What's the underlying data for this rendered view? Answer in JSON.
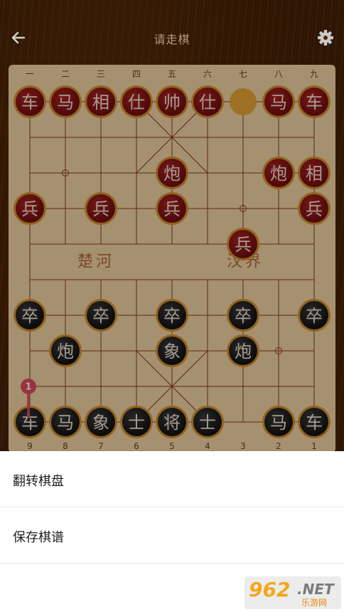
{
  "header": {
    "title": "请走棋"
  },
  "board": {
    "top_numerals": [
      "一",
      "二",
      "三",
      "四",
      "五",
      "六",
      "七",
      "八",
      "九"
    ],
    "bottom_numerals": [
      "9",
      "8",
      "7",
      "6",
      "5",
      "4",
      "3",
      "2",
      "1"
    ],
    "river_left": "楚河",
    "river_right": "汉界",
    "red_pieces": [
      {
        "ch": "车",
        "col": 0,
        "row": 0
      },
      {
        "ch": "马",
        "col": 1,
        "row": 0
      },
      {
        "ch": "相",
        "col": 2,
        "row": 0
      },
      {
        "ch": "仕",
        "col": 3,
        "row": 0
      },
      {
        "ch": "帅",
        "col": 4,
        "row": 0
      },
      {
        "ch": "仕",
        "col": 5,
        "row": 0
      },
      {
        "ch": "马",
        "col": 7,
        "row": 0
      },
      {
        "ch": "车",
        "col": 8,
        "row": 0
      },
      {
        "ch": "炮",
        "col": 4,
        "row": 2
      },
      {
        "ch": "炮",
        "col": 7,
        "row": 2
      },
      {
        "ch": "相",
        "col": 8,
        "row": 2
      },
      {
        "ch": "兵",
        "col": 0,
        "row": 3
      },
      {
        "ch": "兵",
        "col": 2,
        "row": 3
      },
      {
        "ch": "兵",
        "col": 4,
        "row": 3
      },
      {
        "ch": "兵",
        "col": 8,
        "row": 3
      },
      {
        "ch": "兵",
        "col": 6,
        "row": 4
      }
    ],
    "black_pieces": [
      {
        "ch": "卒",
        "col": 0,
        "row": 6
      },
      {
        "ch": "卒",
        "col": 2,
        "row": 6
      },
      {
        "ch": "卒",
        "col": 4,
        "row": 6
      },
      {
        "ch": "卒",
        "col": 6,
        "row": 6
      },
      {
        "ch": "卒",
        "col": 8,
        "row": 6
      },
      {
        "ch": "炮",
        "col": 1,
        "row": 7
      },
      {
        "ch": "象",
        "col": 4,
        "row": 7
      },
      {
        "ch": "炮",
        "col": 6,
        "row": 7
      },
      {
        "ch": "车",
        "col": 0,
        "row": 9
      },
      {
        "ch": "马",
        "col": 1,
        "row": 9
      },
      {
        "ch": "象",
        "col": 2,
        "row": 9
      },
      {
        "ch": "士",
        "col": 3,
        "row": 9
      },
      {
        "ch": "将",
        "col": 4,
        "row": 9
      },
      {
        "ch": "士",
        "col": 5,
        "row": 9
      },
      {
        "ch": "马",
        "col": 7,
        "row": 9
      },
      {
        "ch": "车",
        "col": 8,
        "row": 9
      }
    ],
    "selected_marker": {
      "col": 6,
      "row": 0
    },
    "move_hint": {
      "label": "1",
      "col": 0,
      "row": 8
    }
  },
  "menu": {
    "items": [
      {
        "label": "翻转棋盘"
      },
      {
        "label": "保存棋谱"
      }
    ]
  },
  "watermark": {
    "logo": "962",
    "logo_suffix": ".NET",
    "sub": "乐游网"
  },
  "colors": {
    "board": "#f3d6a6",
    "line": "#8a3a1c",
    "red_piece": "#8c1414",
    "black_piece": "#1c1c1c",
    "rim": "#d8922e",
    "highlight": "#e8a534",
    "hint": "#e24c5c"
  },
  "icons": {
    "back": "arrow-left-icon",
    "settings": "gear-icon"
  }
}
